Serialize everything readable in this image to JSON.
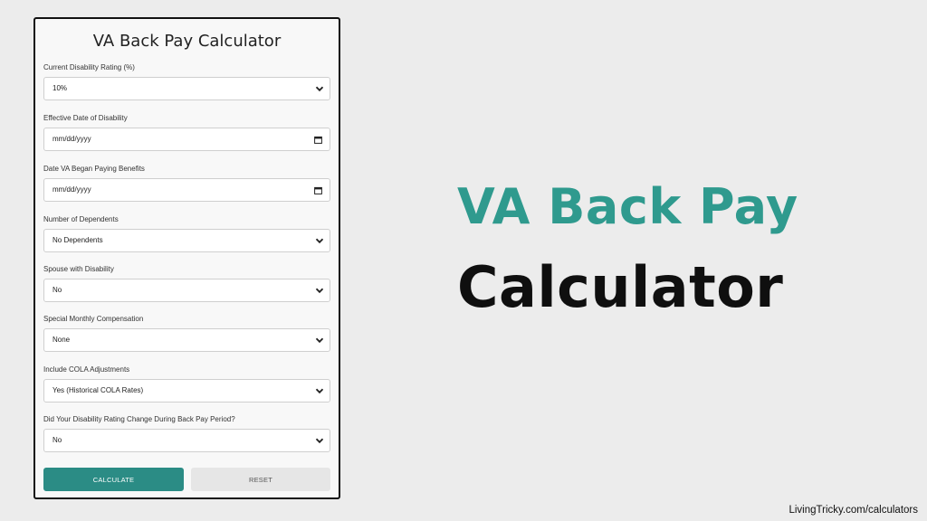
{
  "form": {
    "title": "VA Back Pay Calculator",
    "fields": [
      {
        "label": "Current Disability Rating (%)",
        "value": "10%",
        "kind": "select",
        "icon": "chevron-down-icon"
      },
      {
        "label": "Effective Date of Disability",
        "value": "mm/dd/yyyy",
        "kind": "date",
        "icon": "calendar-icon"
      },
      {
        "label": "Date VA Began Paying Benefits",
        "value": "mm/dd/yyyy",
        "kind": "date",
        "icon": "calendar-icon"
      },
      {
        "label": "Number of Dependents",
        "value": "No Dependents",
        "kind": "select",
        "icon": "chevron-down-icon"
      },
      {
        "label": "Spouse with Disability",
        "value": "No",
        "kind": "select",
        "icon": "chevron-down-icon"
      },
      {
        "label": "Special Monthly Compensation",
        "value": "None",
        "kind": "select",
        "icon": "chevron-down-icon"
      },
      {
        "label": "Include COLA Adjustments",
        "value": "Yes (Historical COLA Rates)",
        "kind": "select",
        "icon": "chevron-down-icon"
      },
      {
        "label": "Did Your Disability Rating Change During Back Pay Period?",
        "value": "No",
        "kind": "select",
        "icon": "chevron-down-icon"
      }
    ],
    "calculate_label": "CALCULATE",
    "reset_label": "RESET"
  },
  "hero": {
    "line1": "VA Back Pay",
    "line2": "Calculator"
  },
  "footer": {
    "text": "LivingTricky.com/calculators"
  },
  "colors": {
    "accent": "#2b8c85",
    "hero_accent": "#2f9a8e",
    "background": "#ececec"
  }
}
